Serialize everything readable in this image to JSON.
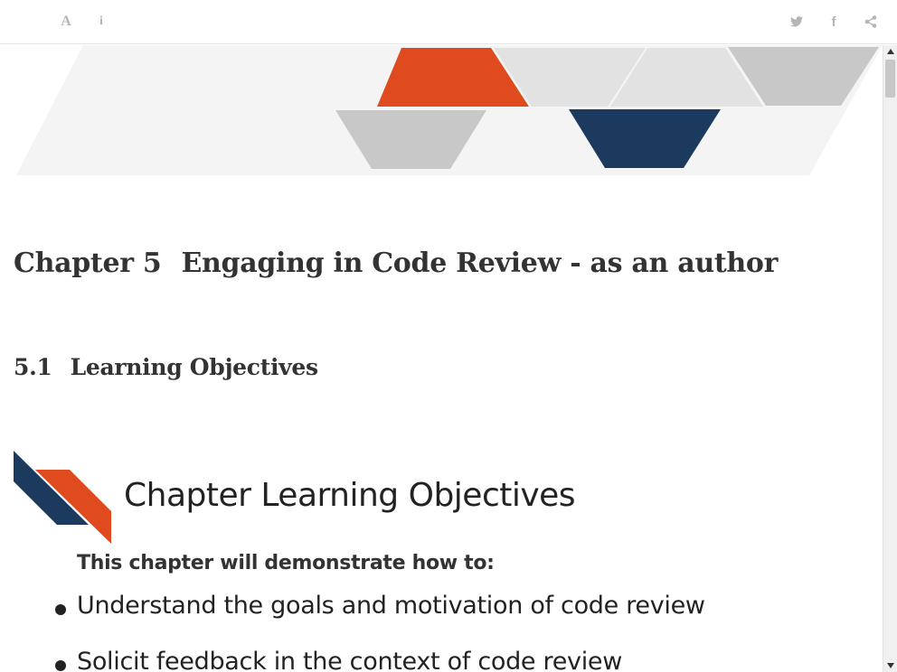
{
  "toolbar": {
    "font_settings_glyph": "A",
    "info_glyph": "i",
    "facebook_glyph": "f"
  },
  "icons": {
    "font": "font-settings-icon",
    "info": "info-icon",
    "twitter": "twitter-icon",
    "facebook": "facebook-icon",
    "share": "share-icon"
  },
  "colors": {
    "accent_orange": "#e04a1f",
    "accent_navy": "#1b3a5e",
    "banner_light": "#f4f4f4",
    "banner_gray": "#c8c8c8"
  },
  "chapter": {
    "number": "Chapter 5",
    "title": "Engaging in Code Review - as an author"
  },
  "section": {
    "number": "5.1",
    "title": "Learning Objectives"
  },
  "objectives": {
    "heading": "Chapter Learning Objectives",
    "intro": "This chapter will demonstrate how to:",
    "items": [
      "Understand the goals and motivation of code review",
      "Solicit feedback in the context of code review"
    ]
  }
}
